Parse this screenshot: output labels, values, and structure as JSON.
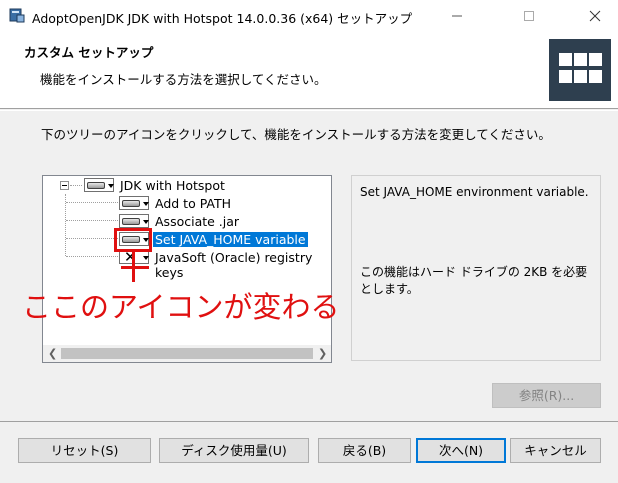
{
  "window": {
    "title": "AdoptOpenJDK JDK with Hotspot 14.0.0.36 (x64) セットアップ"
  },
  "banner": {
    "title": "カスタム セットアップ",
    "subtitle": "機能をインストールする方法を選択してください。"
  },
  "instruction": "下のツリーのアイコンをクリックして、機能をインストールする方法を変更してください。",
  "tree": {
    "items": [
      {
        "label": "JDK with Hotspot",
        "icon": "drive-icon",
        "selected": false
      },
      {
        "label": "Add to PATH",
        "icon": "drive-icon",
        "selected": false
      },
      {
        "label": "Associate .jar",
        "icon": "drive-icon",
        "selected": false
      },
      {
        "label": "Set JAVA_HOME variable",
        "icon": "drive-icon",
        "selected": true
      },
      {
        "label": "JavaSoft (Oracle) registry keys",
        "icon": "x-icon",
        "selected": false
      }
    ]
  },
  "description": {
    "text": "Set JAVA_HOME environment variable.",
    "size_text": "この機能はハード ドライブの 2KB を必要とします。"
  },
  "annotation": {
    "text": "ここのアイコンが変わる",
    "color": "#e01010"
  },
  "buttons": {
    "browse": "参照(R)...",
    "reset": "リセット(S)",
    "disk_usage": "ディスク使用量(U)",
    "back": "戻る(B)",
    "next": "次へ(N)",
    "cancel": "キャンセル"
  },
  "colors": {
    "selection": "#0078d7",
    "logo_bg": "#2e3f4f"
  }
}
